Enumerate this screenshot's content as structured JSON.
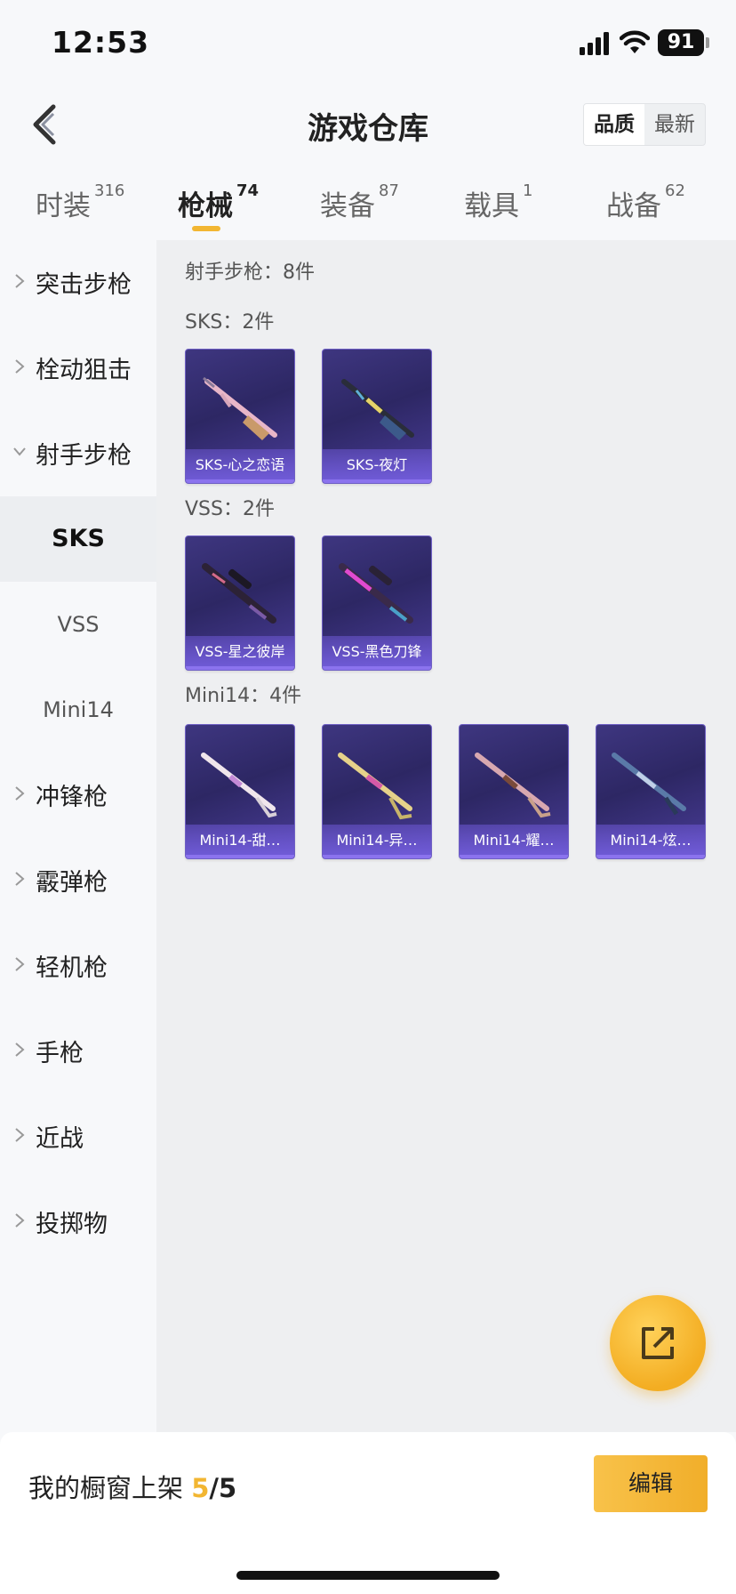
{
  "status_bar": {
    "time": "12:53",
    "battery": "91"
  },
  "header": {
    "title": "游戏仓库",
    "sort_options": [
      "品质",
      "最新"
    ]
  },
  "tabs": [
    {
      "label": "时装",
      "count": "316"
    },
    {
      "label": "枪械",
      "count": "74"
    },
    {
      "label": "装备",
      "count": "87"
    },
    {
      "label": "载具",
      "count": "1"
    },
    {
      "label": "战备",
      "count": "62"
    }
  ],
  "sidebar": {
    "categories": [
      {
        "label": "突击步枪"
      },
      {
        "label": "栓动狙击"
      },
      {
        "label": "射手步枪"
      },
      {
        "label": "冲锋枪"
      },
      {
        "label": "霰弹枪"
      },
      {
        "label": "轻机枪"
      },
      {
        "label": "手枪"
      },
      {
        "label": "近战"
      },
      {
        "label": "投掷物"
      }
    ],
    "subcategories": [
      {
        "label": "SKS"
      },
      {
        "label": "VSS"
      },
      {
        "label": "Mini14"
      }
    ]
  },
  "content": {
    "group_summary": "射手步枪：8件",
    "sections": [
      {
        "title": "SKS：2件",
        "items": [
          {
            "name": "SKS-心之恋语"
          },
          {
            "name": "SKS-夜灯"
          }
        ]
      },
      {
        "title": "VSS：2件",
        "items": [
          {
            "name": "VSS-星之彼岸"
          },
          {
            "name": "VSS-黑色刀锋"
          }
        ]
      },
      {
        "title": "Mini14：4件",
        "items": [
          {
            "name": "Mini14-甜…"
          },
          {
            "name": "Mini14-异…"
          },
          {
            "name": "Mini14-耀…"
          },
          {
            "name": "Mini14-炫…"
          }
        ]
      }
    ]
  },
  "bottom": {
    "shelf_label": "我的橱窗上架",
    "shelf_count": "5",
    "shelf_total": "/5",
    "edit_label": "编辑"
  },
  "colors": {
    "accent": "#f2b632",
    "card_bg": "#3a3278",
    "card_bar": "#7660e2"
  }
}
